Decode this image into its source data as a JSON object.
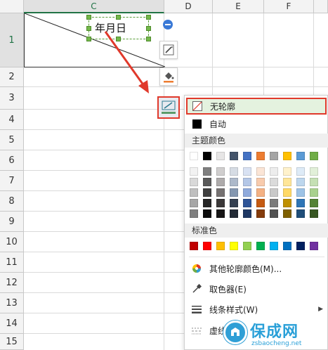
{
  "sheet": {
    "columns": [
      {
        "label": "C"
      },
      {
        "label": "D"
      },
      {
        "label": "E"
      },
      {
        "label": "F"
      }
    ],
    "rows": [
      "1",
      "2",
      "3",
      "4",
      "5",
      "6",
      "7",
      "8",
      "9",
      "10",
      "11",
      "12",
      "13",
      "14",
      "15"
    ]
  },
  "textbox": {
    "text": "年月日"
  },
  "side_tools": {
    "collapse_icon": "minus-circle-icon",
    "edit_icon": "edit-shape-icon",
    "fill_icon": "fill-bucket-icon",
    "outline_icon": "shape-outline-icon"
  },
  "menu": {
    "no_outline_label": "无轮廓",
    "auto_label": "自动",
    "theme_colors_label": "主题颜色",
    "theme_colors_top": [
      "#ffffff",
      "#000000",
      "#e7e6e6",
      "#44546a",
      "#4472c4",
      "#ed7d31",
      "#a5a5a5",
      "#ffc000",
      "#5b9bd5",
      "#70ad47"
    ],
    "theme_colors_shades": [
      [
        "#f2f2f2",
        "#7f7f7f",
        "#d0cece",
        "#d6dce4",
        "#d9e2f3",
        "#fbe5d6",
        "#ededed",
        "#fff2cc",
        "#deebf7",
        "#e2f0d9"
      ],
      [
        "#d9d9d9",
        "#595959",
        "#aeabab",
        "#adb9ca",
        "#b4c7e7",
        "#f8cbad",
        "#dbdbdb",
        "#ffe699",
        "#bdd7ee",
        "#c5e0b4"
      ],
      [
        "#bfbfbf",
        "#3f3f3f",
        "#757171",
        "#8497b0",
        "#8faadc",
        "#f4b183",
        "#c9c9c9",
        "#ffd966",
        "#9dc3e6",
        "#a9d18e"
      ],
      [
        "#a6a6a6",
        "#262626",
        "#3b3838",
        "#333f50",
        "#2f5597",
        "#c55a11",
        "#7b7b7b",
        "#bf9000",
        "#2e75b6",
        "#548235"
      ],
      [
        "#7f7f7f",
        "#0d0d0d",
        "#171616",
        "#222a35",
        "#1f3864",
        "#843c0c",
        "#525252",
        "#7f6000",
        "#1f4e79",
        "#385723"
      ]
    ],
    "standard_colors_label": "标准色",
    "standard_colors": [
      "#c00000",
      "#ff0000",
      "#ffc000",
      "#ffff00",
      "#92d050",
      "#00b050",
      "#00b0f0",
      "#0070c0",
      "#002060",
      "#7030a0"
    ],
    "more_colors_label": "其他轮廓颜色(M)...",
    "eyedropper_label": "取色器(E)",
    "line_style_label": "线条样式(W)",
    "dash_label": "虚线"
  },
  "watermark": {
    "title": "保成网",
    "url": "zsbaocheng.net"
  },
  "colors": {
    "highlight_red": "#e0392b",
    "selection_green": "#74b84a",
    "menu_hover": "#e4f2df"
  }
}
